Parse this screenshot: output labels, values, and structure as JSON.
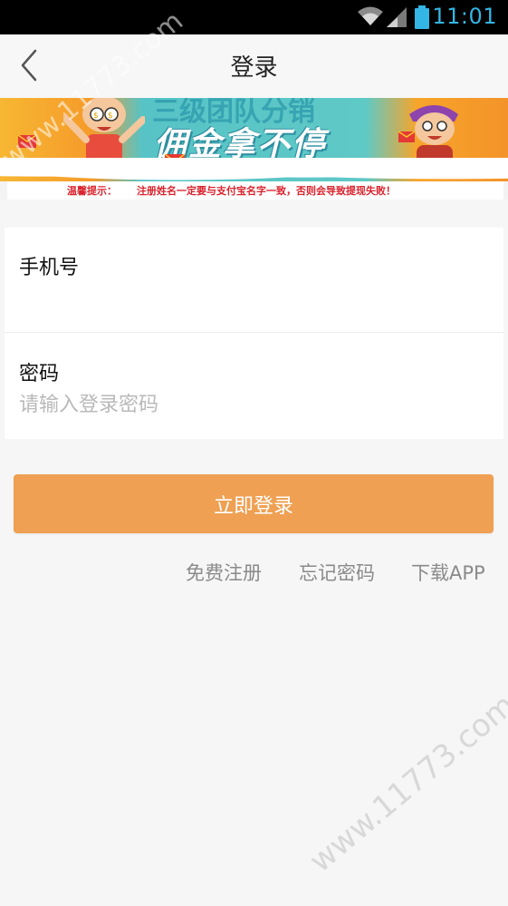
{
  "status_bar": {
    "time": "11:01",
    "icons": [
      "wifi-icon",
      "signal-icon",
      "battery-icon"
    ],
    "accent_color": "#33b5e5"
  },
  "header": {
    "title": "登录",
    "back_icon": "chevron-left-icon"
  },
  "banner": {
    "headline_top": "三级团队分销",
    "headline": "佣金拿不停",
    "notice_label": "温馨提示：",
    "notice_text": "注册姓名一定要与支付宝名字一致，否则会导致提现失败！"
  },
  "form": {
    "phone": {
      "label": "手机号",
      "value": "",
      "placeholder": ""
    },
    "password": {
      "label": "密码",
      "value": "",
      "placeholder": "请输入登录密码"
    }
  },
  "login_button": {
    "label": "立即登录",
    "color": "#efa052"
  },
  "links": {
    "register": "免费注册",
    "forgot_password": "忘记密码",
    "download_app": "下载APP"
  },
  "watermark": {
    "text": "www.11773.com"
  }
}
